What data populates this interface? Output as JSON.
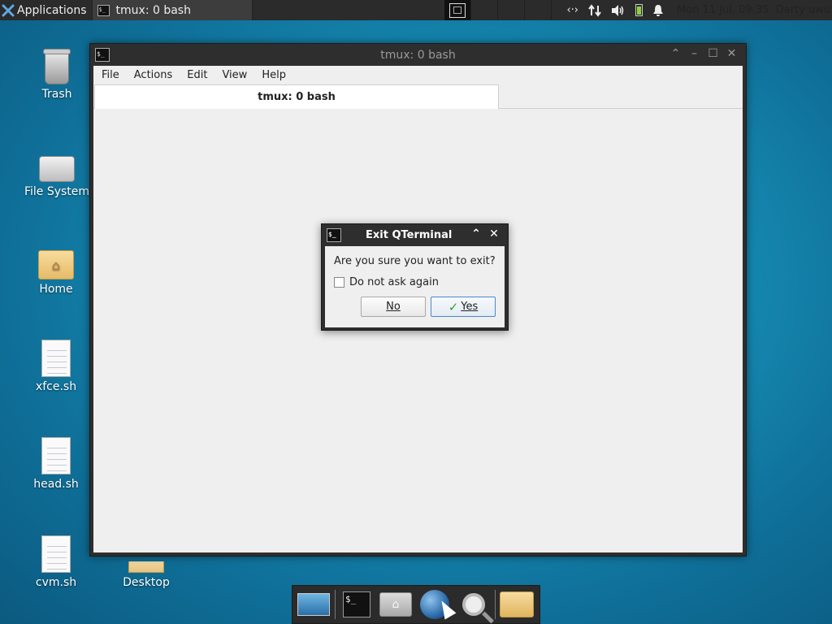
{
  "panel": {
    "applications_label": "Applications",
    "task_label": "tmux: 0 bash",
    "clock": "Mon 11 Jul, 09:35",
    "user": "Darty uwu",
    "network_symbol": "‹·›"
  },
  "desktop": {
    "icons": [
      {
        "label": "Trash",
        "icon": "trash-icon"
      },
      {
        "label": "File System",
        "icon": "drive-icon"
      },
      {
        "label": "Home",
        "icon": "home-folder-icon"
      },
      {
        "label": "xfce.sh",
        "icon": "script-file-icon"
      },
      {
        "label": "head.sh",
        "icon": "script-file-icon"
      },
      {
        "label": "cvm.sh",
        "icon": "script-file-icon"
      },
      {
        "label": "Desktop",
        "icon": "folder-icon"
      }
    ]
  },
  "window": {
    "title": "tmux: 0 bash",
    "menu": [
      "File",
      "Actions",
      "Edit",
      "View",
      "Help"
    ],
    "tab_label": "tmux: 0 bash"
  },
  "dialog": {
    "title": "Exit QTerminal",
    "message": "Are you sure you want to exit?",
    "checkbox_label": "Do not ask again",
    "checkbox_checked": false,
    "no_label": "No",
    "yes_label": "Yes"
  },
  "dock": {
    "items": [
      "show-desktop",
      "terminal",
      "file-manager",
      "web-browser",
      "app-finder",
      "files"
    ]
  },
  "colors": {
    "desktop_bg": "#1790b8",
    "panel_bg": "#2b2b2b",
    "yes_accent": "#4a8ac9",
    "check_green": "#3aa12b"
  }
}
